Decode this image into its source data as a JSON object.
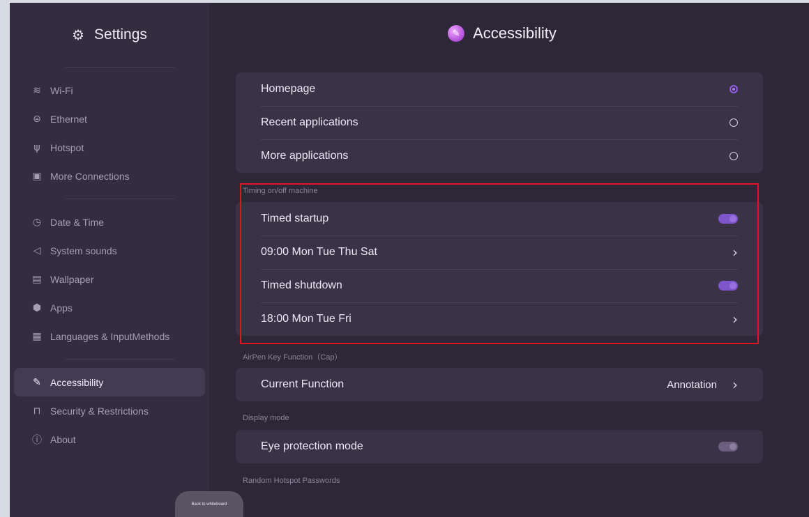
{
  "sidebar": {
    "title": "Settings",
    "groups": [
      [
        {
          "label": "Wi-Fi",
          "icon": "wifi-icon"
        },
        {
          "label": "Ethernet",
          "icon": "ethernet-icon"
        },
        {
          "label": "Hotspot",
          "icon": "hotspot-icon"
        },
        {
          "label": "More Connections",
          "icon": "connections-icon"
        }
      ],
      [
        {
          "label": "Date & Time",
          "icon": "clock-icon"
        },
        {
          "label": "System sounds",
          "icon": "speaker-icon"
        },
        {
          "label": "Wallpaper",
          "icon": "wallpaper-icon"
        },
        {
          "label": "Apps",
          "icon": "apps-icon"
        },
        {
          "label": "Languages & InputMethods",
          "icon": "language-icon"
        }
      ],
      [
        {
          "label": "Accessibility",
          "icon": "accessibility-icon",
          "active": true
        },
        {
          "label": "Security & Restrictions",
          "icon": "lock-icon"
        },
        {
          "label": "About",
          "icon": "info-icon"
        }
      ]
    ]
  },
  "header": {
    "title": "Accessibility"
  },
  "homepage_section": {
    "options": [
      {
        "label": "Homepage",
        "selected": true
      },
      {
        "label": "Recent applications",
        "selected": false
      },
      {
        "label": "More applications",
        "selected": false
      }
    ]
  },
  "timing_section": {
    "label": "Timing on/off machine",
    "rows": [
      {
        "label": "Timed startup",
        "toggle": true
      },
      {
        "label": "09:00  Mon Tue Thu Sat"
      },
      {
        "label": "Timed shutdown",
        "toggle": true
      },
      {
        "label": "18:00  Mon Tue Fri"
      }
    ]
  },
  "airpen_section": {
    "label": "AirPen Key Function（Cap）",
    "row_label": "Current Function",
    "row_value": "Annotation"
  },
  "display_section": {
    "label": "Display mode",
    "row_label": "Eye protection mode",
    "toggle": false
  },
  "hotspot_section": {
    "label": "Random Hotspot Passwords"
  },
  "back_button": {
    "label": "Back to whiteboard"
  },
  "colors": {
    "accent": "#8b5ce0",
    "highlight": "#e2141f"
  }
}
